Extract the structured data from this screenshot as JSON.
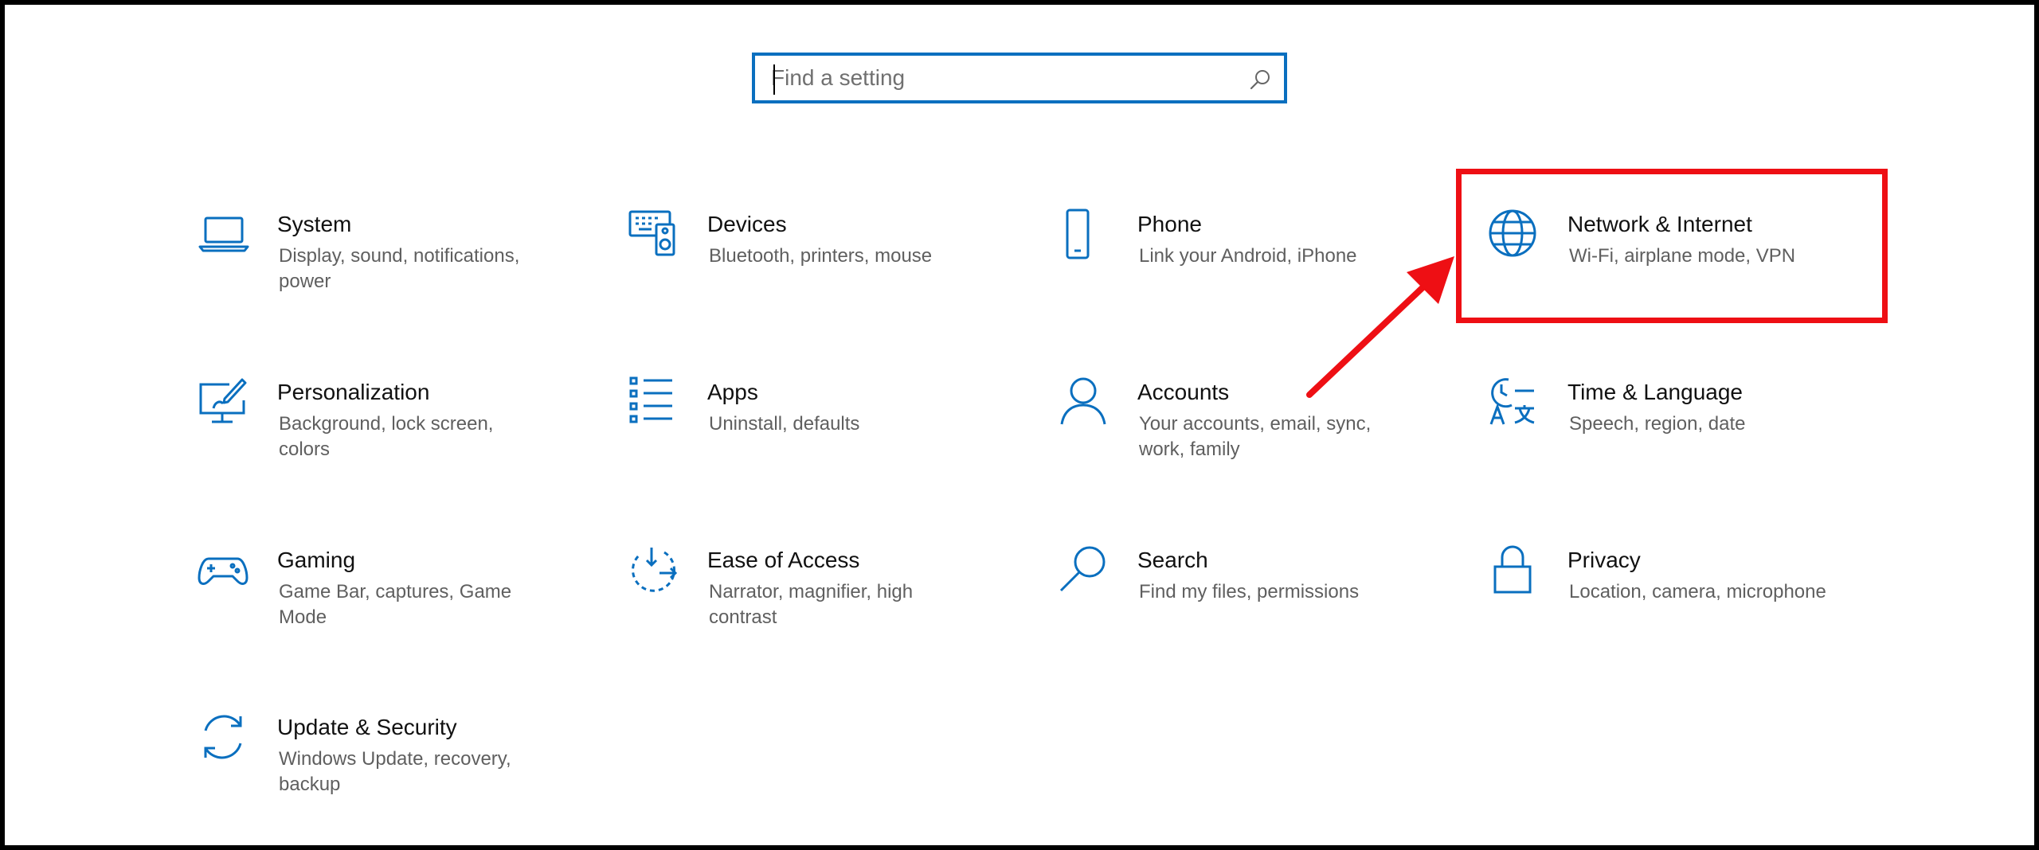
{
  "search": {
    "placeholder": "Find a setting",
    "icon": "search-icon"
  },
  "accent_color": "#0a6fbf",
  "annotation_color": "#ee0f14",
  "tiles": [
    {
      "title": "System",
      "desc": "Display, sound, notifications, power",
      "icon": "laptop-icon"
    },
    {
      "title": "Devices",
      "desc": "Bluetooth, printers, mouse",
      "icon": "keyboard-speaker-icon"
    },
    {
      "title": "Phone",
      "desc": "Link your Android, iPhone",
      "icon": "phone-icon"
    },
    {
      "title": "Network & Internet",
      "desc": "Wi-Fi, airplane mode, VPN",
      "icon": "globe-icon"
    },
    {
      "title": "Personalization",
      "desc": "Background, lock screen, colors",
      "icon": "monitor-brush-icon"
    },
    {
      "title": "Apps",
      "desc": "Uninstall, defaults",
      "icon": "list-icon"
    },
    {
      "title": "Accounts",
      "desc": "Your accounts, email, sync, work, family",
      "icon": "person-icon"
    },
    {
      "title": "Time & Language",
      "desc": "Speech, region, date",
      "icon": "clock-language-icon"
    },
    {
      "title": "Gaming",
      "desc": "Game Bar, captures, Game Mode",
      "icon": "gamepad-icon"
    },
    {
      "title": "Ease of Access",
      "desc": "Narrator, magnifier, high contrast",
      "icon": "ease-of-access-icon"
    },
    {
      "title": "Search",
      "desc": "Find my files, permissions",
      "icon": "magnifier-icon"
    },
    {
      "title": "Privacy",
      "desc": "Location, camera, microphone",
      "icon": "lock-icon"
    },
    {
      "title": "Update & Security",
      "desc": "Windows Update, recovery, backup",
      "icon": "sync-arrows-icon"
    }
  ]
}
